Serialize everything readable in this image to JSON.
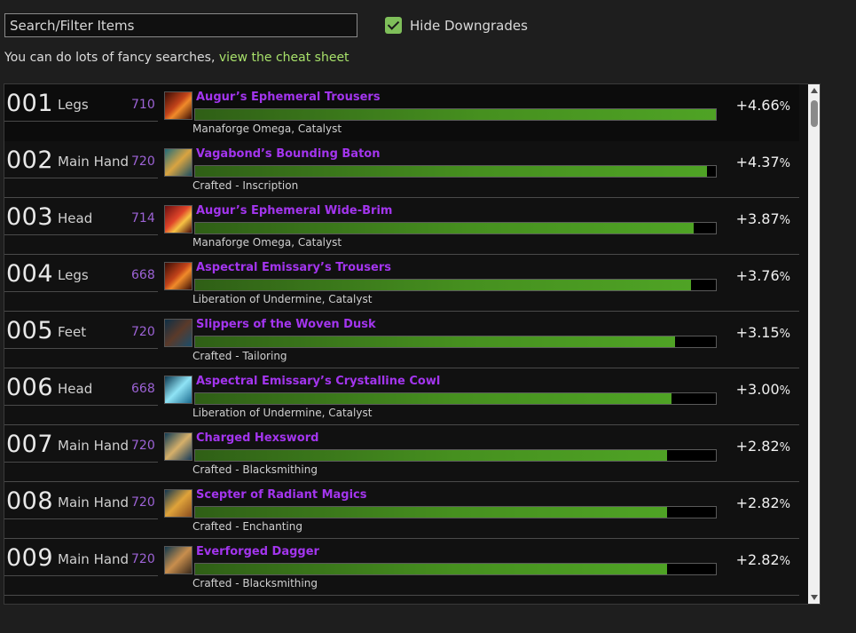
{
  "search": {
    "placeholder": "Search/Filter Items"
  },
  "hide_downgrades": {
    "label": "Hide Downgrades",
    "checked": true
  },
  "hint": {
    "text": "You can do lots of fancy searches, ",
    "link": "view the cheat sheet"
  },
  "colors": {
    "epic": "#a335ee",
    "bar": "#4a9a23",
    "link": "#a7e06a",
    "check": "#7fbf5a"
  },
  "items": [
    {
      "rank": "001",
      "slot": "Legs",
      "ilvl": "710",
      "name": "Augur’s Ephemeral Trousers",
      "source": "Manaforge Omega, Catalyst",
      "pct": "+4.66",
      "fraction": 1.0,
      "icon": "trousers-icon"
    },
    {
      "rank": "002",
      "slot": "Main Hand",
      "ilvl": "720",
      "name": "Vagabond’s Bounding Baton",
      "source": "Crafted - Inscription",
      "pct": "+4.37",
      "fraction": 0.983,
      "icon": "baton-icon"
    },
    {
      "rank": "003",
      "slot": "Head",
      "ilvl": "714",
      "name": "Augur’s Ephemeral Wide-Brim",
      "source": "Manaforge Omega, Catalyst",
      "pct": "+3.87",
      "fraction": 0.957,
      "icon": "hat-icon"
    },
    {
      "rank": "004",
      "slot": "Legs",
      "ilvl": "668",
      "name": "Aspectral Emissary’s Trousers",
      "source": "Liberation of Undermine, Catalyst",
      "pct": "+3.76",
      "fraction": 0.952,
      "icon": "trousers-icon"
    },
    {
      "rank": "005",
      "slot": "Feet",
      "ilvl": "720",
      "name": "Slippers of the Woven Dusk",
      "source": "Crafted - Tailoring",
      "pct": "+3.15",
      "fraction": 0.922,
      "icon": "slippers-icon"
    },
    {
      "rank": "006",
      "slot": "Head",
      "ilvl": "668",
      "name": "Aspectral Emissary’s Crystalline Cowl",
      "source": "Liberation of Undermine, Catalyst",
      "pct": "+3.00",
      "fraction": 0.915,
      "icon": "cowl-icon"
    },
    {
      "rank": "007",
      "slot": "Main Hand",
      "ilvl": "720",
      "name": "Charged Hexsword",
      "source": "Crafted - Blacksmithing",
      "pct": "+2.82",
      "fraction": 0.907,
      "icon": "sword-icon"
    },
    {
      "rank": "008",
      "slot": "Main Hand",
      "ilvl": "720",
      "name": "Scepter of Radiant Magics",
      "source": "Crafted - Enchanting",
      "pct": "+2.82",
      "fraction": 0.907,
      "icon": "scepter-icon"
    },
    {
      "rank": "009",
      "slot": "Main Hand",
      "ilvl": "720",
      "name": "Everforged Dagger",
      "source": "Crafted - Blacksmithing",
      "pct": "+2.82",
      "fraction": 0.907,
      "icon": "dagger-icon"
    }
  ]
}
